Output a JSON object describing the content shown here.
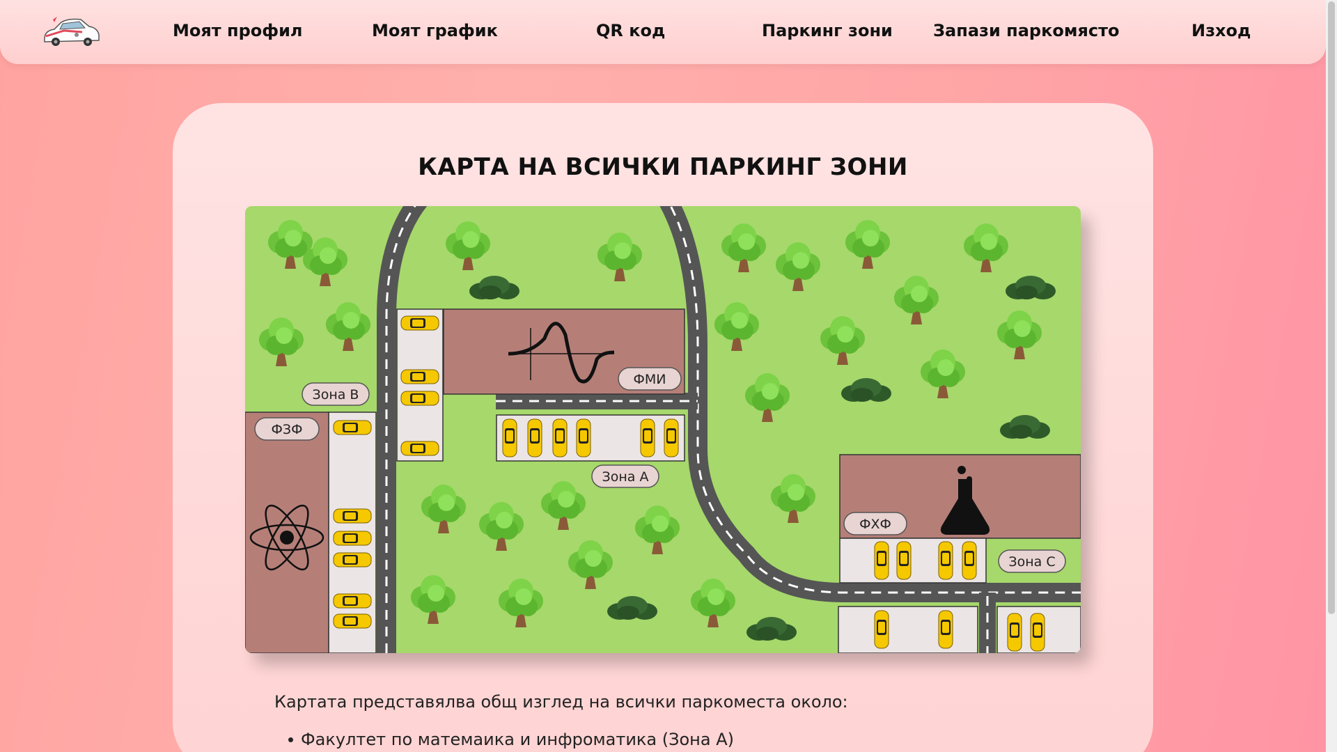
{
  "nav": {
    "items": [
      {
        "label": "Моят профил"
      },
      {
        "label": "Моят график"
      },
      {
        "label": "QR код"
      },
      {
        "label": "Паркинг зони"
      },
      {
        "label": "Запази паркомясто"
      },
      {
        "label": "Изход"
      }
    ]
  },
  "card": {
    "title": "КАРТА НА ВСИЧКИ ПАРКИНГ ЗОНИ"
  },
  "map": {
    "labels": {
      "zone_b": "Зона В",
      "fzf": "ФЗФ",
      "fmi": "ФМИ",
      "zone_a": "Зона А",
      "fhf": "ФХФ",
      "zone_c": "Зона С"
    }
  },
  "description": {
    "intro": "Картата представялва общ изглед на всички паркоместа около:",
    "items": [
      "Факултет по матемаика и инфроматика (Зона А)"
    ]
  },
  "colors": {
    "grass": "#a6d86b",
    "road": "#555555",
    "building": "#b57f78",
    "parking": "#ece5e5",
    "car": "#f5c800"
  }
}
